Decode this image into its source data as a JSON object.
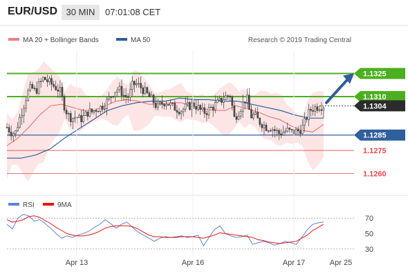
{
  "header": {
    "pair": "EUR/USD",
    "timeframe": "30 MIN",
    "time": "07:01:08 CET"
  },
  "legend": {
    "ma20_bb": "MA 20 + Bollinger Bands",
    "ma50": "MA 50",
    "copyright": "Research © 2019 Trading Central"
  },
  "rsi_legend": {
    "rsi": "RSI",
    "ma9": "9MA"
  },
  "colors": {
    "green": "#4caf1f",
    "red": "#e8484a",
    "blue": "#2f5f9c",
    "dark": "#2b2b2b",
    "band": "#fddcdc",
    "rsi": "#5b84d6",
    "ma9": "#ee1111"
  },
  "chart_data": [
    {
      "type": "line",
      "title": "",
      "ylim": [
        1.1245,
        1.134
      ],
      "x_ticks": [
        "Apr 13",
        "Apr 16",
        "Apr 17",
        "Apr 25"
      ],
      "levels": [
        {
          "value": 1.1325,
          "label": "1.1325",
          "kind": "resistance"
        },
        {
          "value": 1.131,
          "label": "1.1310",
          "kind": "resistance"
        },
        {
          "value": 1.1304,
          "label": "1.1304",
          "kind": "last"
        },
        {
          "value": 1.1285,
          "label": "1.1285",
          "kind": "pivot"
        },
        {
          "value": 1.1275,
          "label": "1.1275",
          "kind": "support"
        },
        {
          "value": 1.126,
          "label": "1.1260",
          "kind": "support"
        }
      ],
      "series": [
        {
          "name": "MA 20 + Bollinger Bands"
        },
        {
          "name": "MA 50"
        }
      ],
      "price_path": [
        1.129,
        1.1287,
        1.1286,
        1.1295,
        1.1303,
        1.1312,
        1.1316,
        1.1313,
        1.1318,
        1.1322,
        1.132,
        1.1318,
        1.1316,
        1.1314,
        1.1305,
        1.1298,
        1.1296,
        1.1297,
        1.1295,
        1.1297,
        1.13,
        1.13,
        1.1302,
        1.1303,
        1.1305,
        1.1308,
        1.1312,
        1.1315,
        1.1314,
        1.131,
        1.131,
        1.1318,
        1.1318,
        1.1316,
        1.1313,
        1.131,
        1.1307,
        1.1303,
        1.1305,
        1.1307,
        1.1305,
        1.1303,
        1.1302,
        1.1301,
        1.1303,
        1.1304,
        1.1305,
        1.1303,
        1.13,
        1.13,
        1.1302,
        1.1304,
        1.1306,
        1.1308,
        1.131,
        1.1311,
        1.1296,
        1.13,
        1.1305,
        1.131,
        1.1297,
        1.1298,
        1.1294,
        1.1292,
        1.129,
        1.129,
        1.1288,
        1.1286,
        1.1287,
        1.1288,
        1.1287,
        1.1287,
        1.1288,
        1.1291,
        1.1298,
        1.1302,
        1.1303,
        1.1304,
        1.1304
      ],
      "ma20": [
        1.1278,
        1.1283,
        1.129,
        1.1298,
        1.1304,
        1.1305,
        1.1303,
        1.1301,
        1.1301,
        1.1304,
        1.1307,
        1.1308,
        1.1307,
        1.1305,
        1.1305,
        1.1306,
        1.1306,
        1.1303,
        1.1302,
        1.1301,
        1.1301,
        1.1304,
        1.1302,
        1.13,
        1.1297,
        1.1295,
        1.1291,
        1.1288,
        1.1287,
        1.1292
      ],
      "ma50": [
        1.127,
        1.127,
        1.1272,
        1.1276,
        1.1283,
        1.1289,
        1.1295,
        1.1301,
        1.1304,
        1.1306,
        1.1307,
        1.1307,
        1.1309,
        1.1308,
        1.1308,
        1.1307,
        1.1307,
        1.1305,
        1.1303,
        1.1301,
        1.1298,
        1.1296,
        1.1296
      ]
    },
    {
      "type": "line",
      "title": "",
      "ylim": [
        20,
        80
      ],
      "y_ticks": [
        70,
        50,
        30
      ],
      "series": [
        {
          "name": "RSI",
          "values": [
            62,
            56,
            70,
            75,
            73,
            66,
            68,
            63,
            57,
            50,
            44,
            47,
            45,
            48,
            50,
            53,
            58,
            62,
            68,
            63,
            57,
            62,
            65,
            58,
            52,
            48,
            44,
            40,
            44,
            46,
            45,
            46,
            47,
            45,
            46,
            48,
            34,
            45,
            55,
            60,
            50,
            47,
            45,
            46,
            48,
            36,
            38,
            40,
            38,
            35,
            37,
            40,
            38,
            36,
            45,
            55,
            62,
            64,
            65
          ]
        },
        {
          "name": "9MA",
          "values": [
            68,
            65,
            66,
            68,
            72,
            73,
            71,
            67,
            63,
            58,
            54,
            50,
            48,
            47,
            47,
            48,
            50,
            53,
            57,
            59,
            60,
            60,
            60,
            59,
            56,
            52,
            48,
            46,
            46,
            45,
            45,
            45,
            46,
            46,
            46,
            45,
            44,
            46,
            48,
            51,
            50,
            49,
            48,
            47,
            46,
            45,
            42,
            41,
            39,
            38,
            37,
            38,
            39,
            40,
            44,
            48,
            54,
            58,
            62
          ]
        }
      ]
    }
  ]
}
